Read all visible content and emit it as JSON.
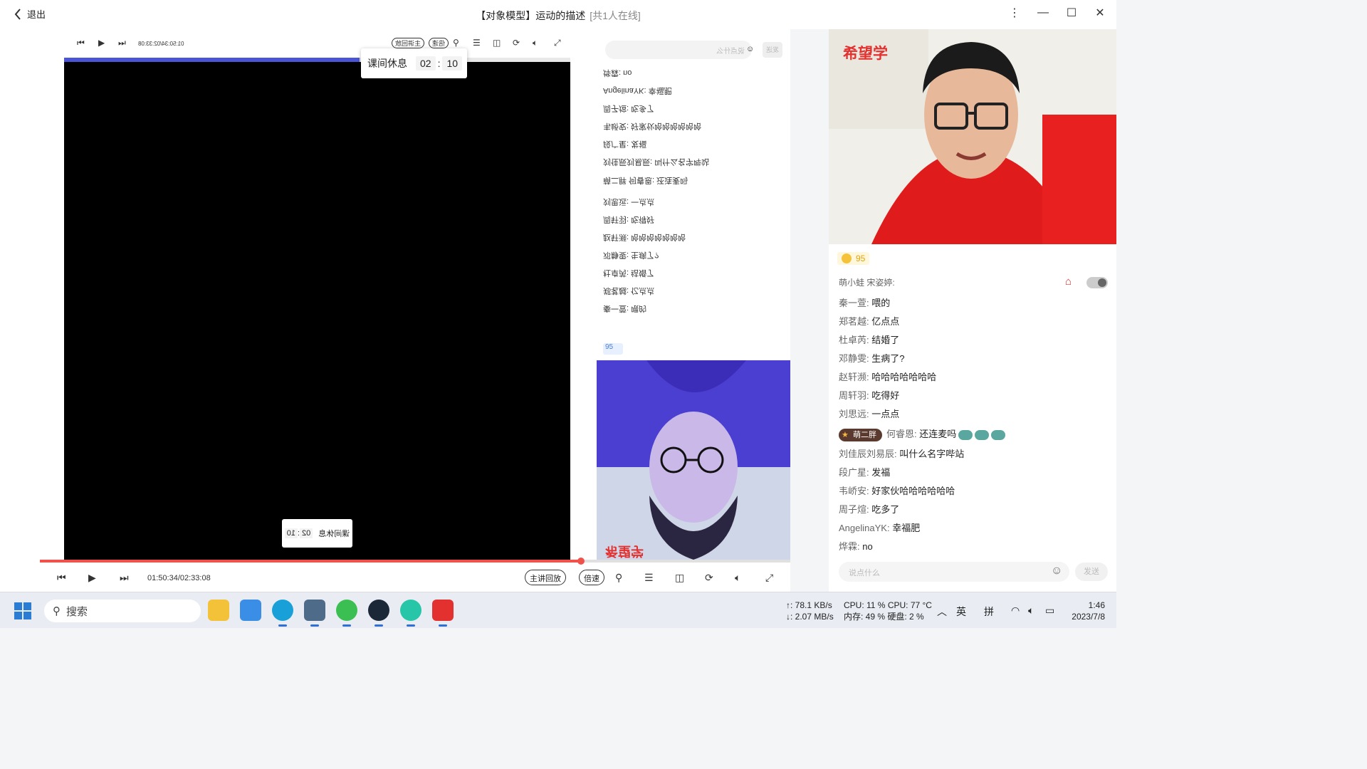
{
  "titlebar": {
    "back_label": "退出",
    "title": "【对象模型】运动的描述",
    "online": "[共1人在线]"
  },
  "player": {
    "inner_time": "01:50:34/02:33:08",
    "break_label": "课间休息",
    "break_min": "02",
    "break_sec": "10",
    "flipped_break_label": "课间休息",
    "flipped_min": "02",
    "flipped_sec": "10",
    "time": "01:50:34/02:33:08",
    "replay_label": "主讲回放",
    "speed_label": "倍速",
    "progress_percent": 72
  },
  "mid_chat": {
    "search_placeholder": "说点什么",
    "send_label": "发送",
    "badge_count": "95",
    "lines": [
      "烨霖: no",
      "AngelinaYK: 幸福肥",
      "周子煊: 吃多了",
      "韦峤安: 好家伙哈哈哈哈哈哈",
      "段广星: 发福",
      "刘佳辰刘易辰: 叫什么名字哔站",
      "萌二胖 何睿恩: 还连麦吗",
      "刘思远: 一点点",
      "周轩羽: 吃得好",
      "赵轩濒: 哈哈哈哈哈哈哈",
      "邓静雯: 生病了?",
      "杜卓芮: 结婚了",
      "郑茗越: 亿点点",
      "秦一萱: 喂的"
    ]
  },
  "right_chat": {
    "brand": "希望学",
    "coin_count": "95",
    "truncated_user": "萌小蛙 宋姿婷:",
    "messages": [
      {
        "user": "秦一萱:",
        "text": "喂的"
      },
      {
        "user": "郑茗越:",
        "text": "亿点点"
      },
      {
        "user": "杜卓芮:",
        "text": "结婚了"
      },
      {
        "user": "邓静雯:",
        "text": "生病了?"
      },
      {
        "user": "赵轩濒:",
        "text": "哈哈哈哈哈哈哈"
      },
      {
        "user": "周轩羽:",
        "text": "吃得好"
      },
      {
        "user": "刘思远:",
        "text": "一点点"
      }
    ],
    "badge_msg": {
      "badge": "萌二胖",
      "user": "何睿恩:",
      "text": "还连麦吗"
    },
    "messages2": [
      {
        "user": "刘佳辰刘易辰:",
        "text": "叫什么名字哔站"
      },
      {
        "user": "段广星:",
        "text": "发福"
      },
      {
        "user": "韦峤安:",
        "text": "好家伙哈哈哈哈哈哈"
      },
      {
        "user": "周子煊:",
        "text": "吃多了"
      },
      {
        "user": "AngelinaYK:",
        "text": "幸福肥"
      },
      {
        "user": "烨霖:",
        "text": "no"
      }
    ],
    "input_placeholder": "说点什么",
    "send_label": "发送"
  },
  "taskbar": {
    "search_label": "搜索",
    "net_up": "↑: 78.1 KB/s",
    "net_down": "↓: 2.07 MB/s",
    "cpu": "CPU: 11 %",
    "cpu_temp": "CPU: 77 °C",
    "mem": "内存: 49 %",
    "disk": "硬盘: 2 %",
    "ime1": "英",
    "ime2": "拼",
    "time": "1:46",
    "date": "2023/7/8"
  },
  "colors": {
    "accent": "#f0514a",
    "inner_progress": "#4a55d6",
    "brand": "#e2312e"
  }
}
